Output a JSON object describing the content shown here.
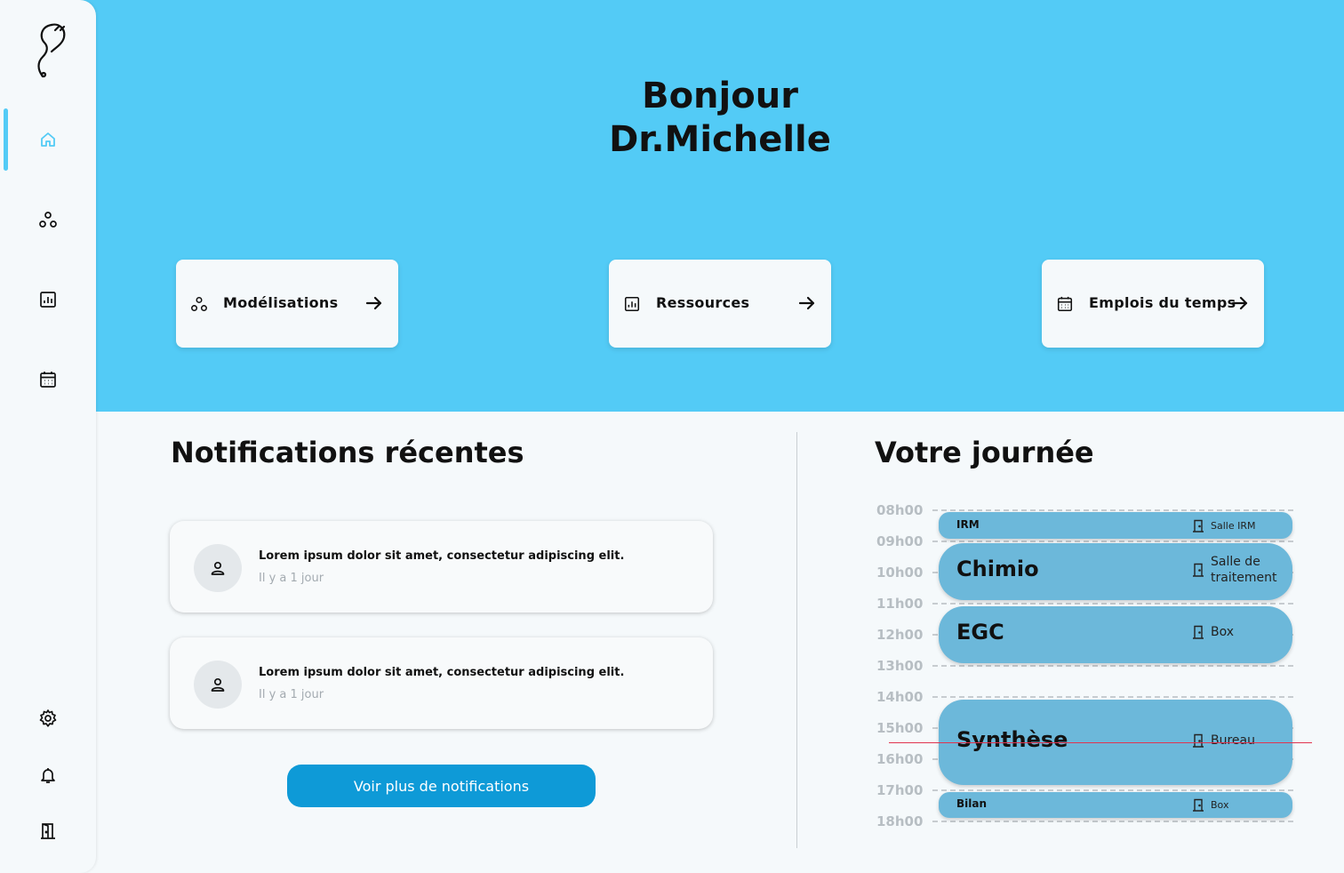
{
  "greeting": {
    "line1": "Bonjour",
    "line2": "Dr.Michelle"
  },
  "shortcuts": [
    {
      "label": "Modélisations",
      "icon": "circles-icon"
    },
    {
      "label": "Ressources",
      "icon": "chart-icon"
    },
    {
      "label": "Emplois du temps",
      "icon": "calendar-icon"
    }
  ],
  "notifications": {
    "title": "Notifications récentes",
    "items": [
      {
        "message": "Lorem ipsum dolor sit amet, consectetur adipiscing elit.",
        "time": "Il y a 1 jour"
      },
      {
        "message": "Lorem ipsum dolor sit amet, consectetur adipiscing elit.",
        "time": "Il y a 1 jour"
      }
    ],
    "more_button": "Voir plus de notifications"
  },
  "day": {
    "title": "Votre journée",
    "hours": [
      "08h00",
      "09h00",
      "10h00",
      "11h00",
      "12h00",
      "13h00",
      "14h00",
      "15h00",
      "16h00",
      "17h00",
      "18h00"
    ],
    "events": [
      {
        "name": "IRM",
        "room": "Salle IRM"
      },
      {
        "name": "Chimio",
        "room_line1": "Salle de",
        "room_line2": "traitement"
      },
      {
        "name": "EGC",
        "room": "Box"
      },
      {
        "name": "Synthèse",
        "room": "Bureau"
      },
      {
        "name": "Bilan",
        "room": "Box"
      }
    ]
  },
  "colors": {
    "hero": "#53cbf6",
    "accent": "#0e9ad7",
    "event": "#6cb8da",
    "current_time": "#e0334f"
  }
}
